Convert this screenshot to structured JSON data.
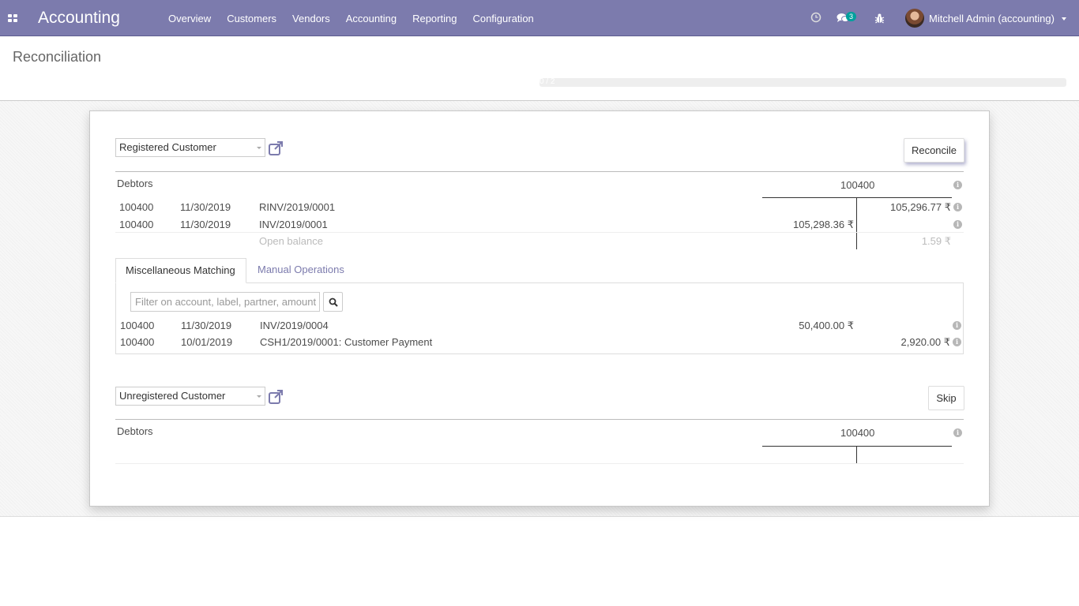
{
  "navbar": {
    "brand": "Accounting",
    "menu": [
      "Overview",
      "Customers",
      "Vendors",
      "Accounting",
      "Reporting",
      "Configuration"
    ],
    "messages_count": "3",
    "user": "Mitchell Admin (accounting)",
    "icons": {
      "apps": "apps-grid-icon",
      "activity": "clock-icon",
      "messages": "chat-icon",
      "debug": "bug-icon"
    }
  },
  "control_panel": {
    "title": "Reconciliation",
    "progress_text": "0 / 2",
    "progress_fraction": 0
  },
  "line1": {
    "partner": "Registered Customer",
    "button": "Reconcile",
    "account_label": "Debtors",
    "account_code": "100400",
    "rows": [
      {
        "account": "100400",
        "date": "11/30/2019",
        "label": "RINV/2019/0001",
        "debit": "",
        "credit": "105,296.77 ₹"
      },
      {
        "account": "100400",
        "date": "11/30/2019",
        "label": "INV/2019/0001",
        "debit": "105,298.36 ₹",
        "credit": ""
      }
    ],
    "open_balance_label": "Open balance",
    "open_balance_value": "1.59 ₹",
    "tabs": [
      "Miscellaneous Matching",
      "Manual Operations"
    ],
    "filter_placeholder": "Filter on account, label, partner, amount",
    "matches": [
      {
        "account": "100400",
        "date": "11/30/2019",
        "label": "INV/2019/0004",
        "debit": "50,400.00 ₹",
        "credit": ""
      },
      {
        "account": "100400",
        "date": "10/01/2019",
        "label": "CSH1/2019/0001: Customer Payment",
        "debit": "",
        "credit": "2,920.00 ₹"
      }
    ]
  },
  "line2": {
    "partner": "Unregistered Customer",
    "button": "Skip",
    "account_label": "Debtors",
    "account_code": "100400"
  },
  "colors": {
    "brand": "#7c7bad",
    "badge": "#00a09d"
  }
}
